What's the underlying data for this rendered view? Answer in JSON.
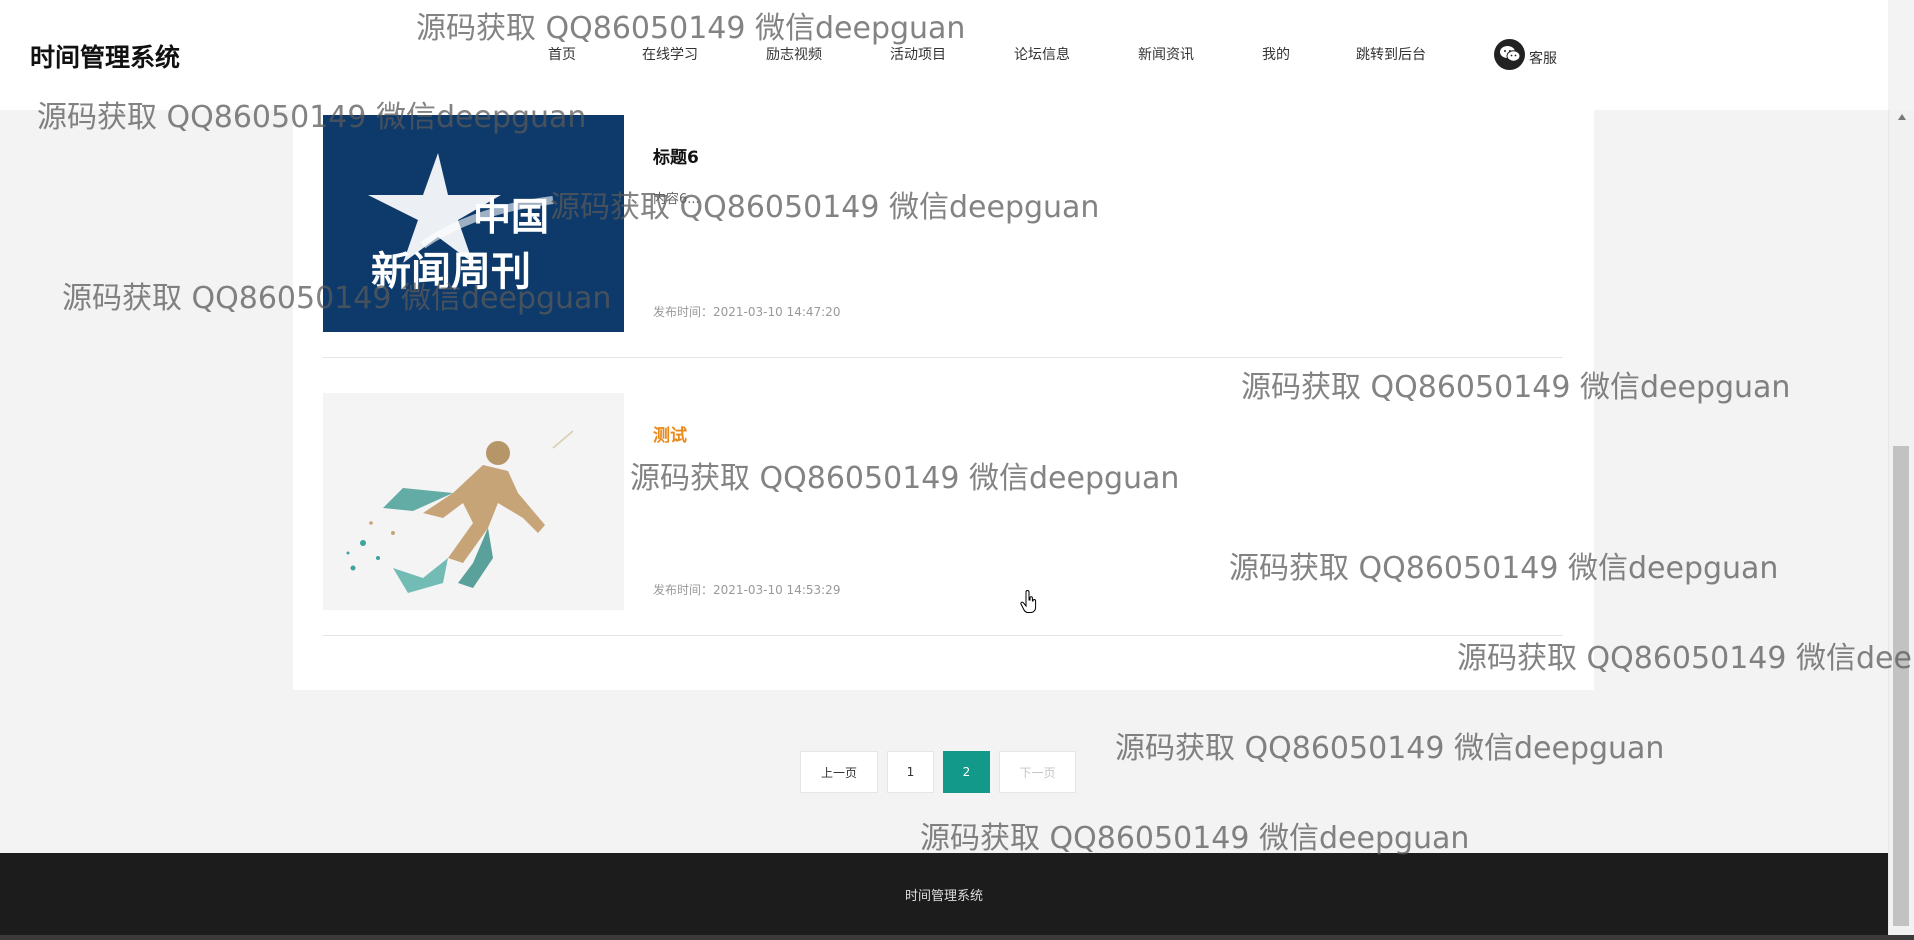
{
  "header": {
    "brand": "时间管理系统",
    "nav": [
      "首页",
      "在线学习",
      "励志视频",
      "活动项目",
      "论坛信息",
      "新闻资讯",
      "我的",
      "跳转到后台"
    ],
    "kefu": "客服"
  },
  "news": [
    {
      "title": "标题6",
      "summary": "内容6...",
      "time": "发布时间：2021-03-10 14:47:20",
      "image_text": [
        "中国",
        "新闻周刊"
      ]
    },
    {
      "title": "测试",
      "time": "发布时间：2021-03-10 14:53:29"
    }
  ],
  "pager": {
    "prev": "上一页",
    "pages": [
      "1",
      "2"
    ],
    "current": "2",
    "next": "下一页"
  },
  "footer": {
    "text": "时间管理系统"
  },
  "watermark": "源码获取 QQ86050149 微信deepguan",
  "colors": {
    "accent": "#13998a",
    "active_title": "#e8891b",
    "footer_bg": "#1c1c1c"
  }
}
